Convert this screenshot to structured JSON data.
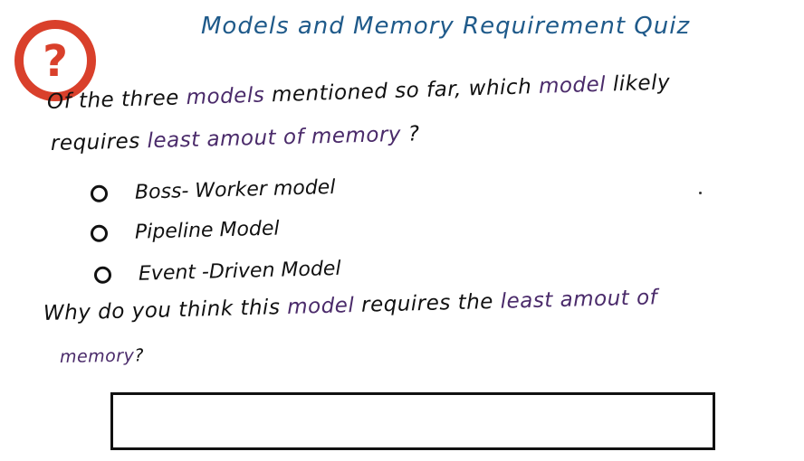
{
  "title": "Models and Memory Requirement Quiz",
  "quiz_icon": {
    "symbol": "?",
    "color": "#d9402b"
  },
  "question": {
    "line1_a": "Of the three ",
    "line1_b": "models",
    "line1_c": " mentioned so far, which ",
    "line1_d": "model",
    "line1_e": " likely",
    "line2_a": "requires ",
    "line2_b": "least amout of memory",
    "line2_c": " ?"
  },
  "options": [
    {
      "label": "Boss- Worker model"
    },
    {
      "label": "Pipeline Model"
    },
    {
      "label": "Event -Driven Model"
    }
  ],
  "why": {
    "line1_a": "Why do you think this ",
    "line1_b": "model",
    "line1_c": " requires the ",
    "line1_d": "least amout of",
    "line2_a": "memory",
    "line2_b": "?"
  },
  "answer": {
    "value": ""
  },
  "colors": {
    "title": "#1f5a8a",
    "accent": "#4a2a6a",
    "ink": "#111111",
    "icon": "#d9402b"
  }
}
